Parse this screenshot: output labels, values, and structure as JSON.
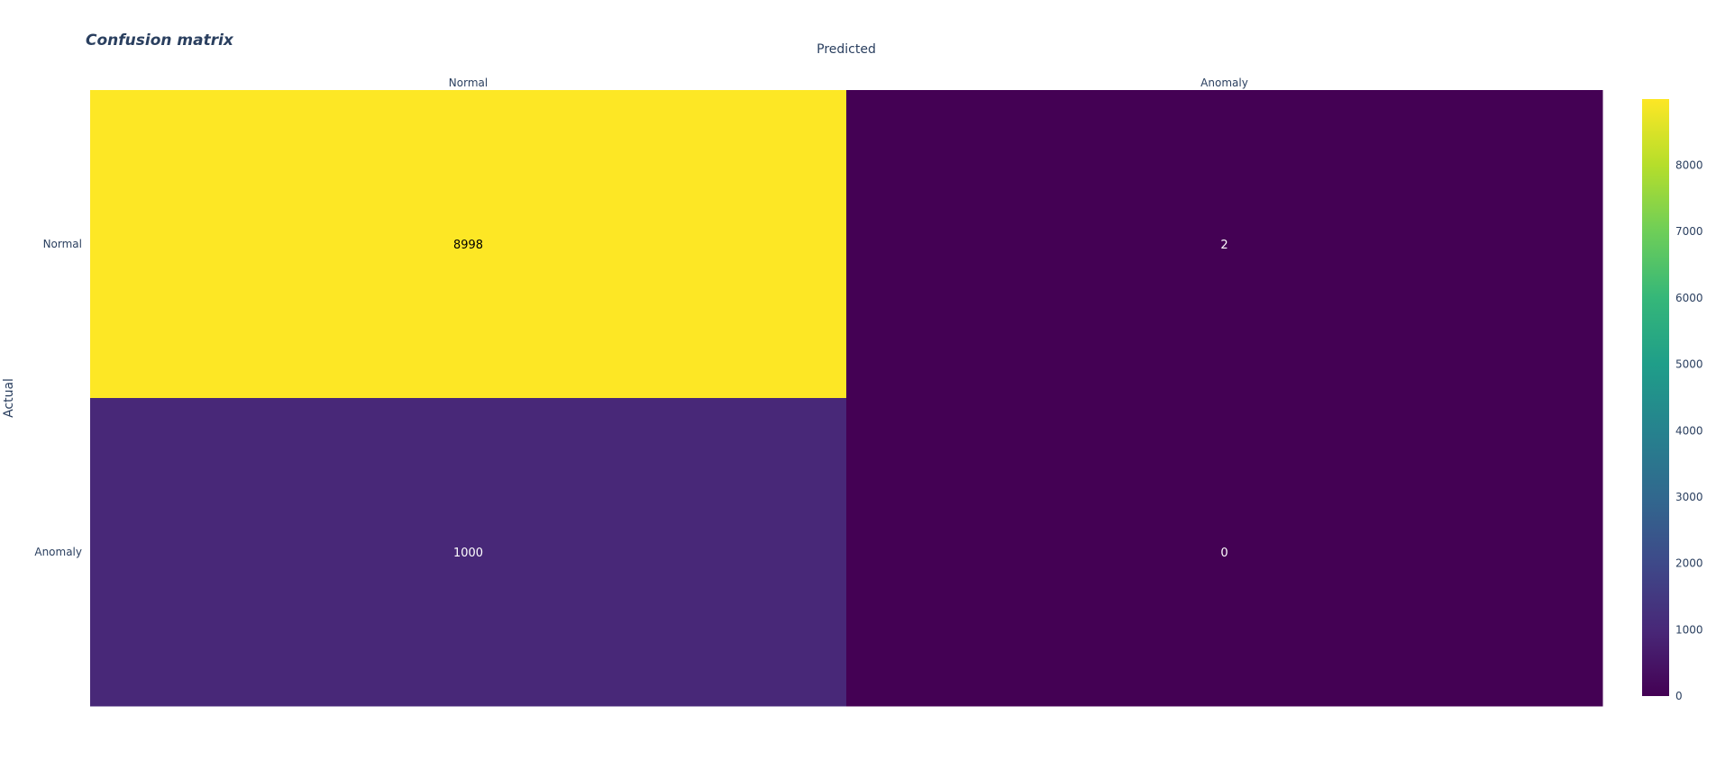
{
  "chart_data": {
    "type": "heatmap",
    "title": "Confusion matrix",
    "xlabel": "Predicted",
    "ylabel": "Actual",
    "x_categories": [
      "Normal",
      "Anomaly"
    ],
    "y_categories": [
      "Normal",
      "Anomaly"
    ],
    "z": [
      [
        8998,
        2
      ],
      [
        1000,
        0
      ]
    ],
    "colorscale": "Viridis",
    "zlim": [
      0,
      8998
    ],
    "colorbar_ticks": [
      0,
      1000,
      2000,
      3000,
      4000,
      5000,
      6000,
      7000,
      8000
    ],
    "x_axis_side": "top"
  }
}
